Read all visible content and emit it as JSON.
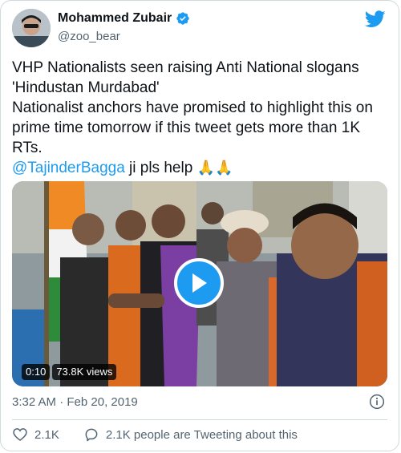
{
  "author": {
    "display_name": "Mohammed Zubair",
    "handle": "@zoo_bear",
    "verified": true
  },
  "tweet": {
    "lines": [
      "VHP Nationalists seen raising Anti National slogans",
      "'Hindustan Murdabad'",
      "Nationalist anchors have promised to highlight this on",
      "prime time tomorrow if this tweet gets more than 1K",
      "RTs."
    ],
    "mention": "@TajinderBagga",
    "mention_suffix": " ji pls help ",
    "emoji": "🙏🙏"
  },
  "media": {
    "duration": "0:10",
    "views": "73.8K views"
  },
  "meta": {
    "timestamp": "3:32 AM · Feb 20, 2019"
  },
  "actions": {
    "likes": "2.1K",
    "tweeting": "2.1K people are Tweeting about this"
  },
  "colors": {
    "accent": "#1d9bf0",
    "text": "#0f1419",
    "muted": "#536471",
    "border": "#cfd9de"
  },
  "icons": [
    "twitter-bird-icon",
    "verified-badge-icon",
    "play-icon",
    "info-icon",
    "heart-icon",
    "speech-bubble-icon"
  ]
}
